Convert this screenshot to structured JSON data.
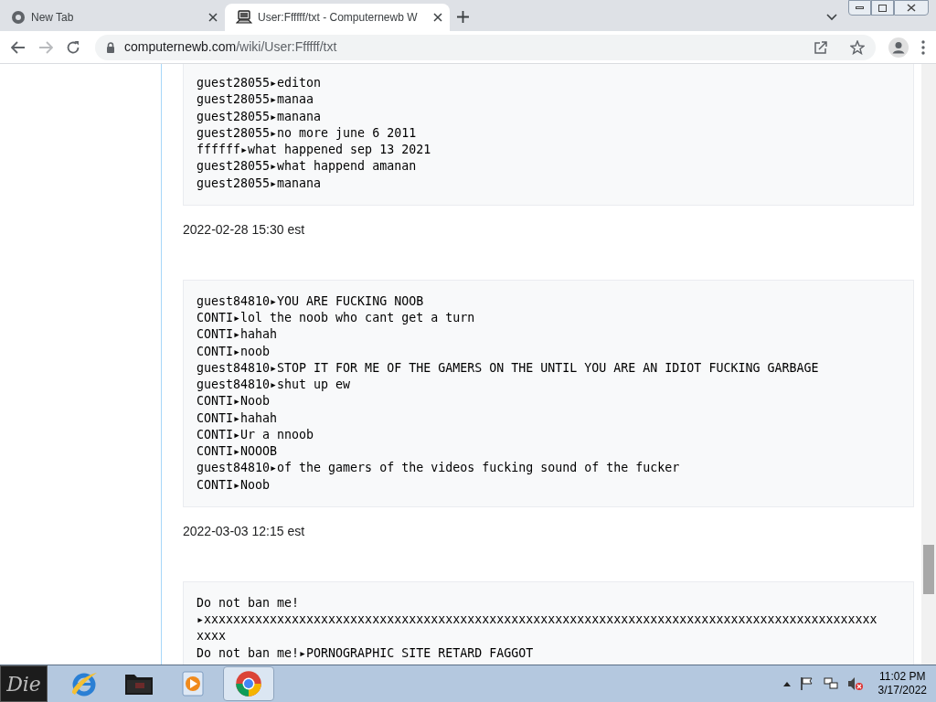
{
  "tabs": [
    {
      "title": "New Tab",
      "selected": false
    },
    {
      "title": "User:Ffffff/txt - Computernewb W",
      "selected": true
    }
  ],
  "address": {
    "url_host": "computernewb.com",
    "url_path": "/wiki/User:Ffffff/txt"
  },
  "content": [
    {
      "kind": "log",
      "lines": [
        "guest28055▸editon",
        "guest28055▸manaa",
        "guest28055▸manana",
        "guest28055▸no more june 6 2011",
        "ffffff▸what happened sep 13 2021",
        "guest28055▸what happend amanan",
        "guest28055▸manana"
      ]
    },
    {
      "kind": "date",
      "text": "2022-02-28 15:30 est"
    },
    {
      "kind": "log",
      "lines": [
        "guest84810▸YOU ARE FUCKING NOOB",
        "CONTI▸lol the noob who cant get a turn",
        "CONTI▸hahah",
        "CONTI▸noob",
        "guest84810▸STOP IT FOR ME OF THE GAMERS ON THE UNTIL YOU ARE AN IDIOT FUCKING GARBAGE",
        "guest84810▸shut up ew",
        "CONTI▸Noob",
        "CONTI▸hahah",
        "CONTI▸Ur a nnoob",
        "CONTI▸NOOOB",
        "guest84810▸of the gamers of the videos fucking sound of the fucker",
        "CONTI▸Noob"
      ]
    },
    {
      "kind": "date",
      "text": "2022-03-03 12:15 est"
    },
    {
      "kind": "log",
      "lines": [
        "Do not ban me!",
        "▸xxxxxxxxxxxxxxxxxxxxxxxxxxxxxxxxxxxxxxxxxxxxxxxxxxxxxxxxxxxxxxxxxxxxxxxxxxxxxxxxxxxxxxxxxxxxxxxx",
        "Do not ban me!▸PORNOGRAPHIC SITE RETARD FAGGOT"
      ]
    }
  ],
  "taskbar": {
    "start_label": "Die",
    "apps": [
      {
        "kind": "ie",
        "selected": false
      },
      {
        "kind": "folder",
        "selected": false
      },
      {
        "kind": "media",
        "selected": false
      },
      {
        "kind": "chrome",
        "selected": true
      }
    ],
    "clock_time": "11:02 PM",
    "clock_date": "3/17/2022"
  }
}
